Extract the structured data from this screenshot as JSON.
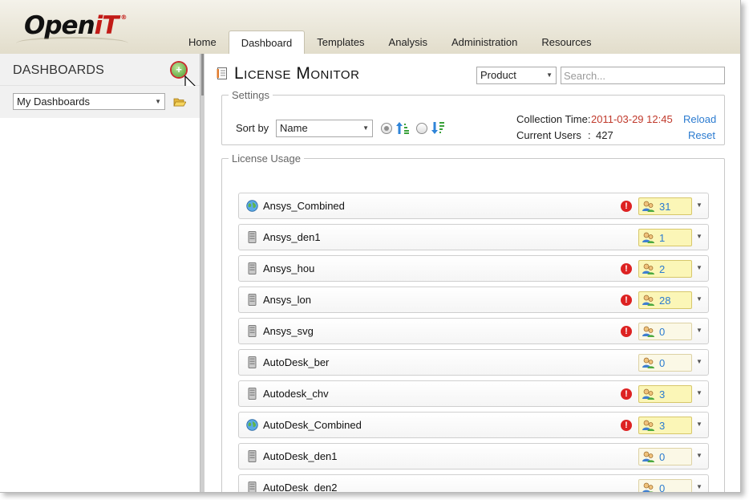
{
  "header": {
    "logo_open": "Open",
    "logo_it": "iT",
    "logo_reg": "®",
    "tabs": [
      {
        "label": "Home"
      },
      {
        "label": "Dashboard"
      },
      {
        "label": "Templates"
      },
      {
        "label": "Analysis"
      },
      {
        "label": "Administration"
      },
      {
        "label": "Resources"
      }
    ],
    "active_tab": "Dashboard"
  },
  "sidebar": {
    "title": "DASHBOARDS",
    "select_value": "My Dashboards",
    "add_glyph": "+"
  },
  "main": {
    "title": "License Monitor",
    "product_select": "Product",
    "search_placeholder": "Search...",
    "settings": {
      "legend": "Settings",
      "sort_label": "Sort by",
      "sort_value": "Name",
      "collection_label": "Collection Time:",
      "collection_time": "2011-03-29 12:45",
      "current_users_label": "Current Users",
      "current_users_sep": ":",
      "current_users_value": "427",
      "reload": "Reload",
      "reset": "Reset"
    },
    "usage": {
      "legend": "License Usage",
      "alert_glyph": "!",
      "rows": [
        {
          "name": "Ansys_Combined",
          "type": "globe",
          "alert": true,
          "count": "31",
          "active": true
        },
        {
          "name": "Ansys_den1",
          "type": "server",
          "alert": false,
          "count": "1",
          "active": true
        },
        {
          "name": "Ansys_hou",
          "type": "server",
          "alert": true,
          "count": "2",
          "active": true
        },
        {
          "name": "Ansys_lon",
          "type": "server",
          "alert": true,
          "count": "28",
          "active": true
        },
        {
          "name": "Ansys_svg",
          "type": "server",
          "alert": true,
          "count": "0",
          "active": false
        },
        {
          "name": "AutoDesk_ber",
          "type": "server",
          "alert": false,
          "count": "0",
          "active": false
        },
        {
          "name": "Autodesk_chv",
          "type": "server",
          "alert": true,
          "count": "3",
          "active": true
        },
        {
          "name": "AutoDesk_Combined",
          "type": "globe",
          "alert": true,
          "count": "3",
          "active": true
        },
        {
          "name": "AutoDesk_den1",
          "type": "server",
          "alert": false,
          "count": "0",
          "active": false
        },
        {
          "name": "AutoDesk_den2",
          "type": "server",
          "alert": false,
          "count": "0",
          "active": false
        }
      ]
    }
  },
  "colors": {
    "accent_link": "#2b7bd0",
    "alert_red": "#dd2222",
    "time_red": "#c0392b",
    "count_active_bg": "#fbf6b7"
  }
}
